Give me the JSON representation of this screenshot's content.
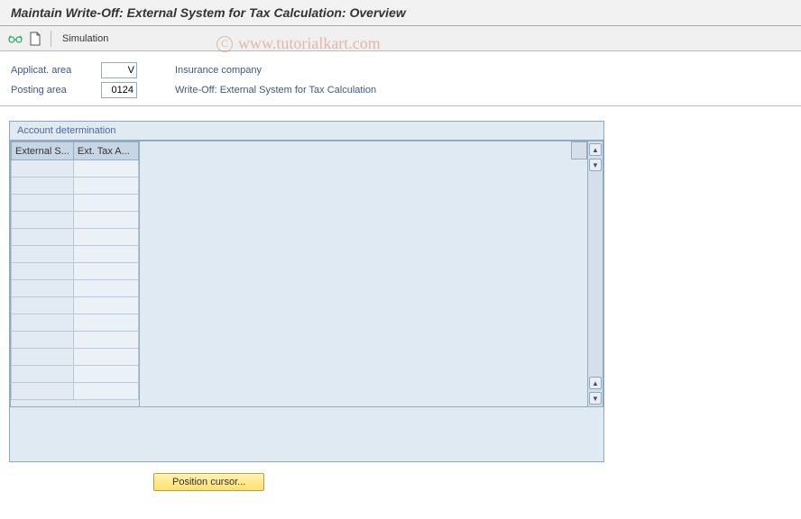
{
  "title": "Maintain Write-Off: External System for Tax Calculation: Overview",
  "toolbar": {
    "simulation": "Simulation"
  },
  "fields": {
    "applicat_label": "Applicat. area",
    "applicat_value": "V",
    "applicat_desc": "Insurance company",
    "posting_label": "Posting area",
    "posting_value": "0124",
    "posting_desc": "Write-Off: External System for Tax Calculation"
  },
  "panel": {
    "title": "Account determination",
    "col1": "External S...",
    "col2": "Ext. Tax A..."
  },
  "buttons": {
    "position": "Position cursor..."
  },
  "watermark": {
    "c": "C",
    "text": "www.tutorialkart.com"
  }
}
